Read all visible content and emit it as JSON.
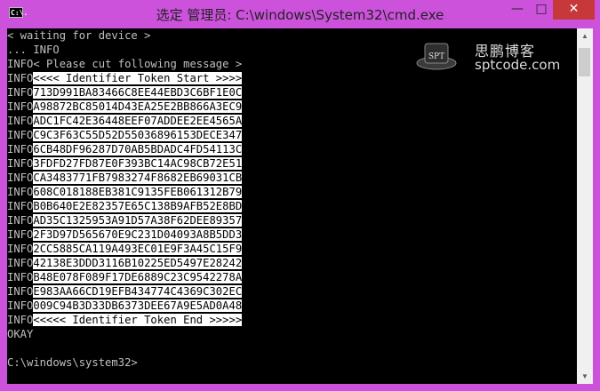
{
  "window": {
    "title": "选定 管理员: C:\\windows\\System32\\cmd.exe",
    "icon_label": "C:\\.",
    "buttons": {
      "minimize": "—",
      "maximize": "□",
      "close": "✕"
    }
  },
  "watermark": {
    "cn": "思鹏博客",
    "domain": "sptcode.com",
    "badge": "SPT"
  },
  "console_lines": [
    {
      "prefix": "",
      "text": "< waiting for device >",
      "hl": false
    },
    {
      "prefix": "",
      "text": "... INFO",
      "hl": false
    },
    {
      "prefix": "INFO",
      "text": "< Please cut following message >",
      "hl": false
    },
    {
      "prefix": "INFO",
      "text": "<<<< Identifier Token Start >>>>",
      "hl": true
    },
    {
      "prefix": "INFO",
      "text": "713D991BA83466C8EE44EBD3C6BF1E0C",
      "hl": true
    },
    {
      "prefix": "INFO",
      "text": "A98872BC85014D43EA25E2BB866A3EC9",
      "hl": true
    },
    {
      "prefix": "INFO",
      "text": "ADC1FC42E36448EEF07ADDEE2EE4565A",
      "hl": true
    },
    {
      "prefix": "INFO",
      "text": "C9C3F63C55D52D55036896153DECE347",
      "hl": true
    },
    {
      "prefix": "INFO",
      "text": "6CB48DF96287D70AB5BDADC4FD54113C",
      "hl": true
    },
    {
      "prefix": "INFO",
      "text": "3FDFD27FD87E0F393BC14AC98CB72E51",
      "hl": true
    },
    {
      "prefix": "INFO",
      "text": "CA3483771FB7983274F8682EB69031CB",
      "hl": true
    },
    {
      "prefix": "INFO",
      "text": "608C018188EB381C9135FEB061312B79",
      "hl": true
    },
    {
      "prefix": "INFO",
      "text": "B0B640E2E82357E65C138B9AFB52E8BD",
      "hl": true
    },
    {
      "prefix": "INFO",
      "text": "AD35C1325953A91D57A38F62DEE89357",
      "hl": true
    },
    {
      "prefix": "INFO",
      "text": "2F3D97D565670E9C231D04093A8B5DD3",
      "hl": true
    },
    {
      "prefix": "INFO",
      "text": "2CC5885CA119A493EC01E9F3A45C15F9",
      "hl": true
    },
    {
      "prefix": "INFO",
      "text": "42138E3DDD3116B10225ED5497E28242",
      "hl": true
    },
    {
      "prefix": "INFO",
      "text": "B48E078F089F17DE6889C23C9542278A",
      "hl": true
    },
    {
      "prefix": "INFO",
      "text": "E983AA66CD19EFB434774C4369C302EC",
      "hl": true
    },
    {
      "prefix": "INFO",
      "text": "009C94B3D33DB6373DEE67A9E5AD0A48",
      "hl": true
    },
    {
      "prefix": "INFO",
      "text": "<<<<< Identifier Token End >>>>>",
      "hl": true
    },
    {
      "prefix": "",
      "text": "OKAY",
      "hl": false
    },
    {
      "prefix": "",
      "text": "",
      "hl": false
    },
    {
      "prefix": "",
      "text": "C:\\windows\\system32>",
      "hl": false
    }
  ]
}
